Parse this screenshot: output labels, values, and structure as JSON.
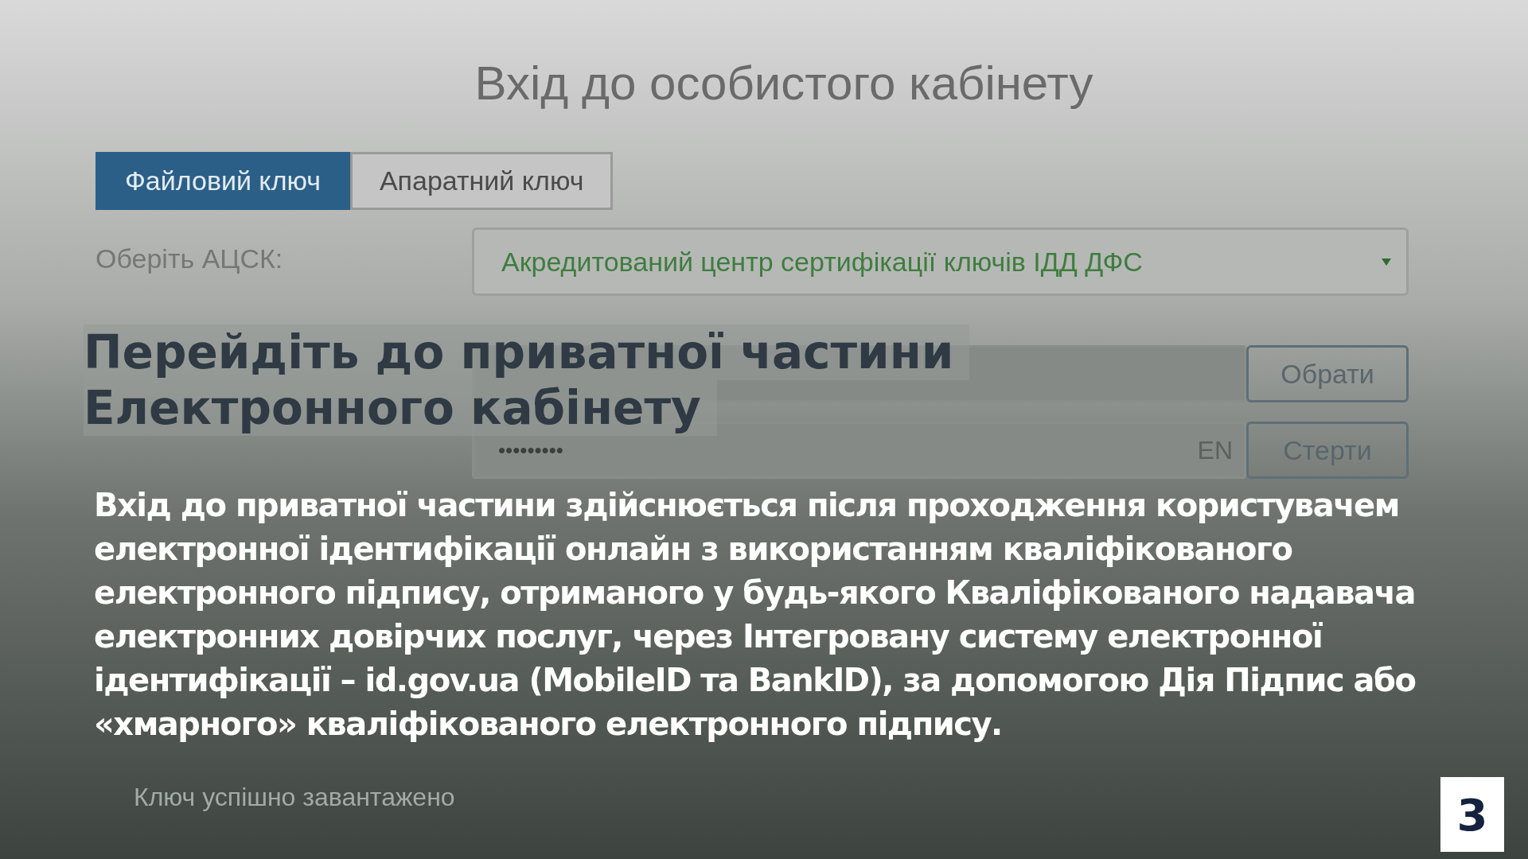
{
  "login_form": {
    "title": "Вхід до особистого кабінету",
    "tabs": [
      {
        "label": "Файловий ключ",
        "selected": true
      },
      {
        "label": "Апаратний ключ",
        "selected": false
      }
    ],
    "ca_label": "Оберіть АЦСК:",
    "ca_select": {
      "value": "Акредитований центр сертифікації ключів ІДД ДФС"
    },
    "choose_button": "Обрати",
    "password": {
      "value": "•••••••••",
      "language": "EN"
    },
    "clear_button": "Стерти",
    "status": "Ключ успішно завантажено"
  },
  "overlay": {
    "heading": [
      "Перейдіть до приватної частини",
      "Електронного кабінету"
    ],
    "paragraph": "Вхід до приватної частини здійснюється після проходження користувачем електронної ідентифікації онлайн з використанням кваліфікованого електронного підпису, отриманого у будь-якого Кваліфікованого надавача електронних довірчих послуг, через Інтегровану систему електронної ідентифікації – id.gov.ua (MobileID та BankID), за допомогою Дія Підпис або «хмарного» кваліфікованого електронного підпису.",
    "page_number": "3"
  }
}
